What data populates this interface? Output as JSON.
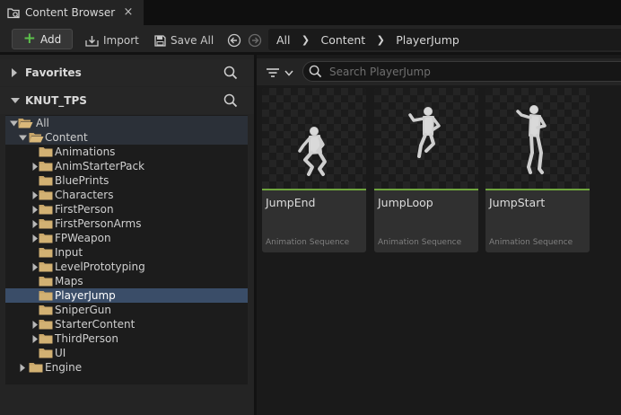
{
  "tab": {
    "title": "Content Browser",
    "close": "×"
  },
  "toolbar": {
    "add_label": "Add",
    "import_label": "Import",
    "save_all_label": "Save All"
  },
  "breadcrumb": [
    "All",
    "Content",
    "PlayerJump"
  ],
  "sections": {
    "favorites": "Favorites",
    "project": "KNUT_TPS"
  },
  "tree": [
    {
      "label": "All",
      "depth": 0,
      "expanded": true
    },
    {
      "label": "Content",
      "depth": 1,
      "expanded": true
    },
    {
      "label": "Animations",
      "depth": 2,
      "expanded": null
    },
    {
      "label": "AnimStarterPack",
      "depth": 2,
      "expanded": false
    },
    {
      "label": "BluePrints",
      "depth": 2,
      "expanded": null
    },
    {
      "label": "Characters",
      "depth": 2,
      "expanded": false
    },
    {
      "label": "FirstPerson",
      "depth": 2,
      "expanded": false
    },
    {
      "label": "FirstPersonArms",
      "depth": 2,
      "expanded": false
    },
    {
      "label": "FPWeapon",
      "depth": 2,
      "expanded": false
    },
    {
      "label": "Input",
      "depth": 2,
      "expanded": null
    },
    {
      "label": "LevelPrototyping",
      "depth": 2,
      "expanded": false
    },
    {
      "label": "Maps",
      "depth": 2,
      "expanded": null
    },
    {
      "label": "PlayerJump",
      "depth": 2,
      "expanded": null,
      "selected": true
    },
    {
      "label": "SniperGun",
      "depth": 2,
      "expanded": null
    },
    {
      "label": "StarterContent",
      "depth": 2,
      "expanded": false
    },
    {
      "label": "ThirdPerson",
      "depth": 2,
      "expanded": false
    },
    {
      "label": "UI",
      "depth": 2,
      "expanded": null
    },
    {
      "label": "Engine",
      "depth": 1,
      "expanded": false
    }
  ],
  "search": {
    "placeholder": "Search PlayerJump",
    "value": ""
  },
  "assets": [
    {
      "name": "JumpEnd",
      "type": "Animation Sequence",
      "pose": "crouch"
    },
    {
      "name": "JumpLoop",
      "type": "Animation Sequence",
      "pose": "loop"
    },
    {
      "name": "JumpStart",
      "type": "Animation Sequence",
      "pose": "start"
    }
  ],
  "colors": {
    "accent_add": "#5cc04b",
    "asset_bar": "#6fa53d",
    "selection": "#3a4d68",
    "folder": "#c9a669"
  }
}
